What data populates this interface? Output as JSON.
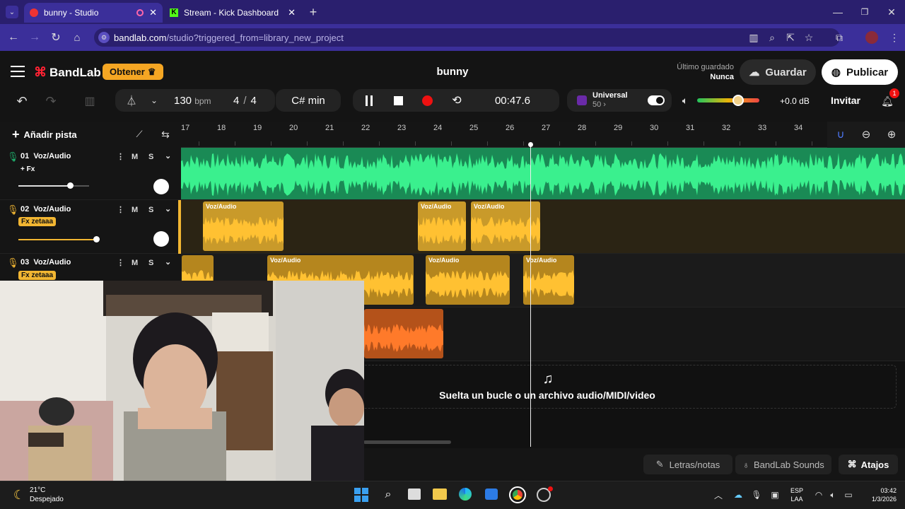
{
  "browser": {
    "tabs": [
      {
        "title": "bunny - Studio"
      },
      {
        "title": "Stream - Kick Dashboard"
      }
    ],
    "url": "bandlab.com/studio?triggered_from=library_new_project",
    "url_domain": "bandlab.com",
    "url_path": "/studio?triggered_from=library_new_project"
  },
  "header": {
    "brand": "BandLab",
    "get_button": "Obtener",
    "project_title": "bunny",
    "last_saved_label": "Último guardado",
    "last_saved_value": "Nunca",
    "save_button": "Guardar",
    "publish_button": "Publicar"
  },
  "toolbar": {
    "tempo": "130",
    "tempo_unit": "bpm",
    "time_sig_num": "4",
    "time_sig_den": "4",
    "key": "C# min",
    "time": "00:47.6",
    "preset_name": "Universal",
    "preset_value": "50",
    "volume_db": "+0.0 dB",
    "invite": "Invitar",
    "notification_count": "1"
  },
  "timeline": {
    "add_track": "Añadir pista",
    "ruler": [
      "17",
      "18",
      "19",
      "20",
      "21",
      "22",
      "23",
      "24",
      "25",
      "26",
      "27",
      "28",
      "29",
      "30",
      "31",
      "32",
      "33",
      "34"
    ]
  },
  "tracks": [
    {
      "number": "01",
      "name": "Voz/Audio",
      "fx": "+ Fx",
      "mute": "M",
      "solo": "S",
      "volume": 0.73
    },
    {
      "number": "02",
      "name": "Voz/Audio",
      "fx": "Fx zetaaa",
      "mute": "M",
      "solo": "S",
      "volume": 1.0
    },
    {
      "number": "03",
      "name": "Voz/Audio",
      "fx": "Fx zetaaa",
      "mute": "M",
      "solo": "S"
    }
  ],
  "clips": {
    "label": "Voz/Audio"
  },
  "dropzone": {
    "text": "Suelta un bucle o un archivo audio/MIDI/video"
  },
  "footer": {
    "lyrics": "Letras/notas",
    "sounds": "BandLab Sounds",
    "shortcuts": "Atajos"
  },
  "taskbar": {
    "temp": "21°C",
    "weather": "Despejado",
    "lang1": "ESP",
    "lang2": "LAA",
    "clock": "03:42",
    "date": "1/3/2026"
  },
  "colors": {
    "browser": "#3b2f9a",
    "track1": "#1fae6c",
    "track2": "#f2b632",
    "track4": "#e8701f",
    "accent": "#f5a623"
  }
}
